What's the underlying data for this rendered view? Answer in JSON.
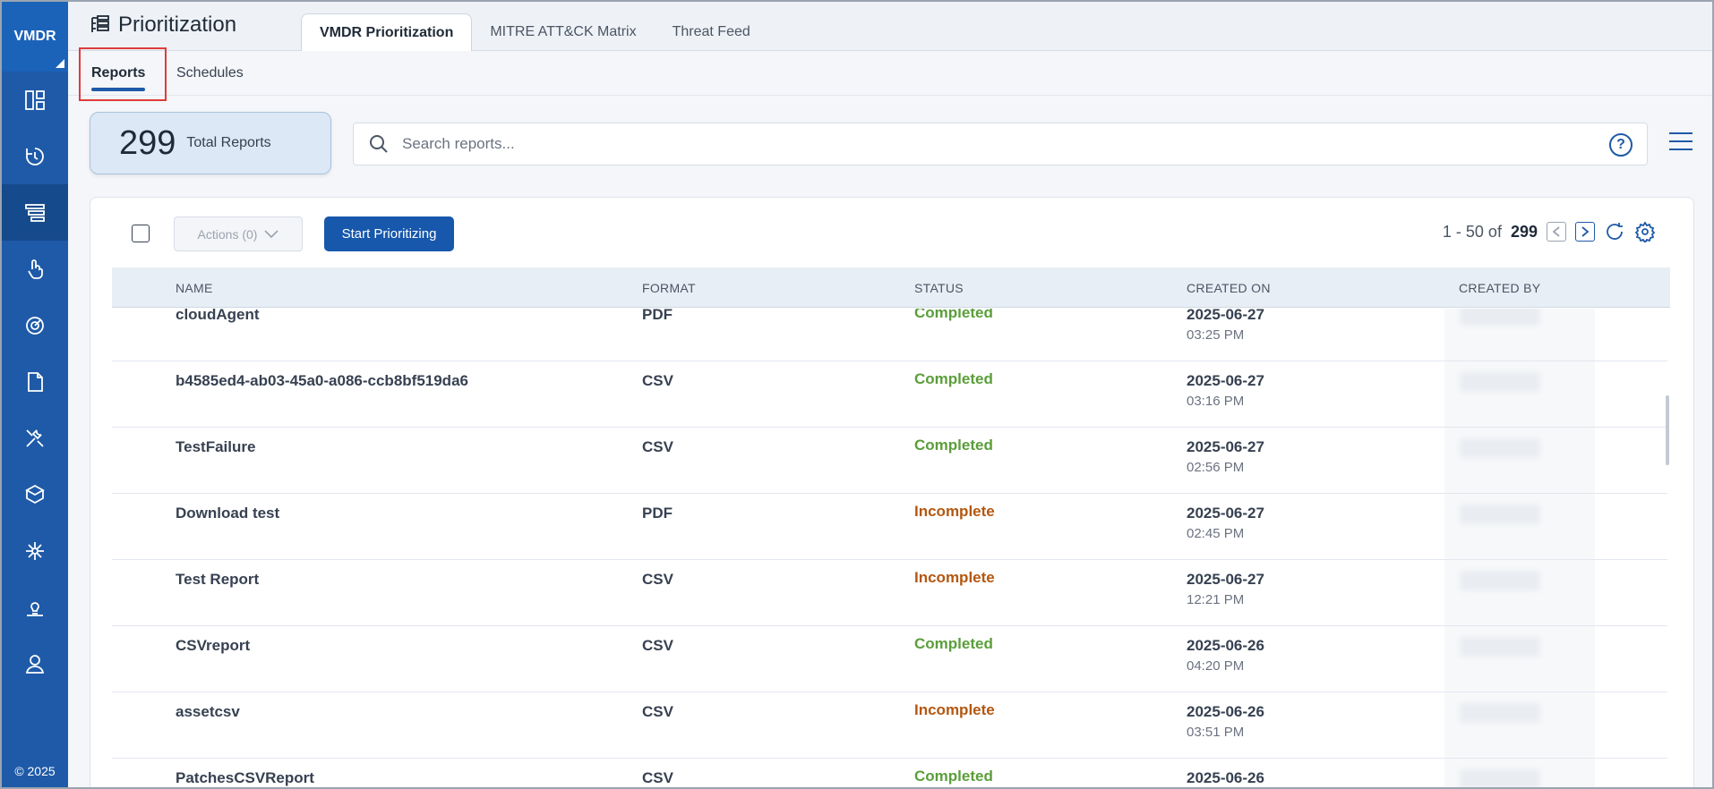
{
  "app": {
    "brand": "VMDR",
    "title": "Prioritization",
    "copyright": "© 2025"
  },
  "top_tabs": [
    {
      "label": "VMDR Prioritization",
      "active": true
    },
    {
      "label": "MITRE ATT&CK Matrix",
      "active": false
    },
    {
      "label": "Threat Feed",
      "active": false
    }
  ],
  "sub_tabs": [
    {
      "label": "Reports",
      "active": true
    },
    {
      "label": "Schedules",
      "active": false
    }
  ],
  "summary": {
    "total": "299",
    "label": "Total Reports"
  },
  "search": {
    "placeholder": "Search reports...",
    "value": "",
    "help": "?"
  },
  "toolbar": {
    "actions_label": "Actions (0)",
    "start_label": "Start Prioritizing",
    "range": "1 - 50 of",
    "total": "299"
  },
  "table": {
    "columns": [
      "NAME",
      "FORMAT",
      "STATUS",
      "CREATED ON",
      "CREATED BY"
    ],
    "rows": [
      {
        "name": "cloudAgent",
        "format": "PDF",
        "status": "Completed",
        "date": "2025-06-27",
        "time": "03:25 PM"
      },
      {
        "name": "b4585ed4-ab03-45a0-a086-ccb8bf519da6",
        "format": "CSV",
        "status": "Completed",
        "date": "2025-06-27",
        "time": "03:16 PM"
      },
      {
        "name": "TestFailure",
        "format": "CSV",
        "status": "Completed",
        "date": "2025-06-27",
        "time": "02:56 PM"
      },
      {
        "name": "Download test",
        "format": "PDF",
        "status": "Incomplete",
        "date": "2025-06-27",
        "time": "02:45 PM"
      },
      {
        "name": "Test Report",
        "format": "CSV",
        "status": "Incomplete",
        "date": "2025-06-27",
        "time": "12:21 PM"
      },
      {
        "name": "CSVreport",
        "format": "CSV",
        "status": "Completed",
        "date": "2025-06-26",
        "time": "04:20 PM"
      },
      {
        "name": "assetcsv",
        "format": "CSV",
        "status": "Incomplete",
        "date": "2025-06-26",
        "time": "03:51 PM"
      },
      {
        "name": "PatchesCSVReport",
        "format": "CSV",
        "status": "Completed",
        "date": "2025-06-26",
        "time": ""
      }
    ]
  },
  "colors": {
    "sidebar": "#1e5aa8",
    "primary": "#1758ac",
    "completed": "#5a9e3a",
    "incomplete": "#b4570f",
    "focus": "#e03b3b"
  },
  "icons": {
    "sidebar": [
      "dashboard-icon",
      "history-icon",
      "prioritization-icon",
      "touch-icon",
      "radar-icon",
      "document-icon",
      "tools-icon",
      "cube-icon",
      "network-icon",
      "lamp-icon",
      "user-icon"
    ]
  }
}
